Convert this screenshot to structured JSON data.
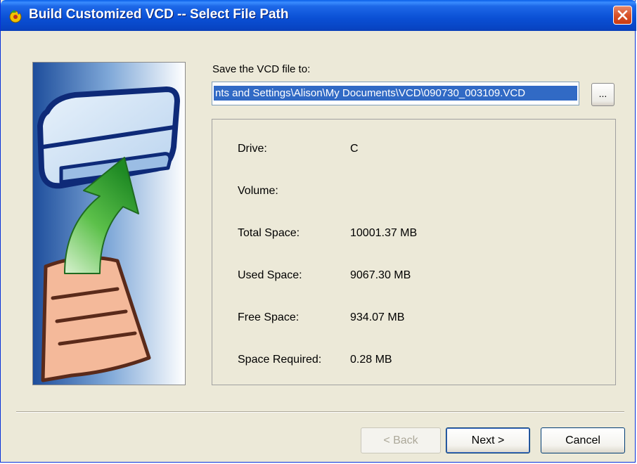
{
  "window": {
    "title": "Build Customized VCD  --  Select File Path"
  },
  "form": {
    "save_label": "Save the VCD file to:",
    "path_value": "nts and Settings\\Alison\\My Documents\\VCD\\090730_003109.VCD",
    "browse_label": "..."
  },
  "info": {
    "rows": [
      {
        "label": "Drive:",
        "value": "C"
      },
      {
        "label": "Volume:",
        "value": ""
      },
      {
        "label": "Total Space:",
        "value": "10001.37 MB"
      },
      {
        "label": "Used Space:",
        "value": "9067.30 MB"
      },
      {
        "label": "Free Space:",
        "value": "934.07 MB"
      },
      {
        "label": "Space Required:",
        "value": "0.28 MB"
      }
    ]
  },
  "buttons": {
    "back": "< Back",
    "next": "Next >",
    "cancel": "Cancel"
  },
  "colors": {
    "title_bar": "#0A4FD4",
    "window_bg": "#ECE9D8",
    "selection": "#316AC5",
    "close_button": "#D9542A"
  },
  "icons": [
    "app-icon",
    "close-icon",
    "drive-illustration",
    "arrow-illustration",
    "document-illustration"
  ]
}
